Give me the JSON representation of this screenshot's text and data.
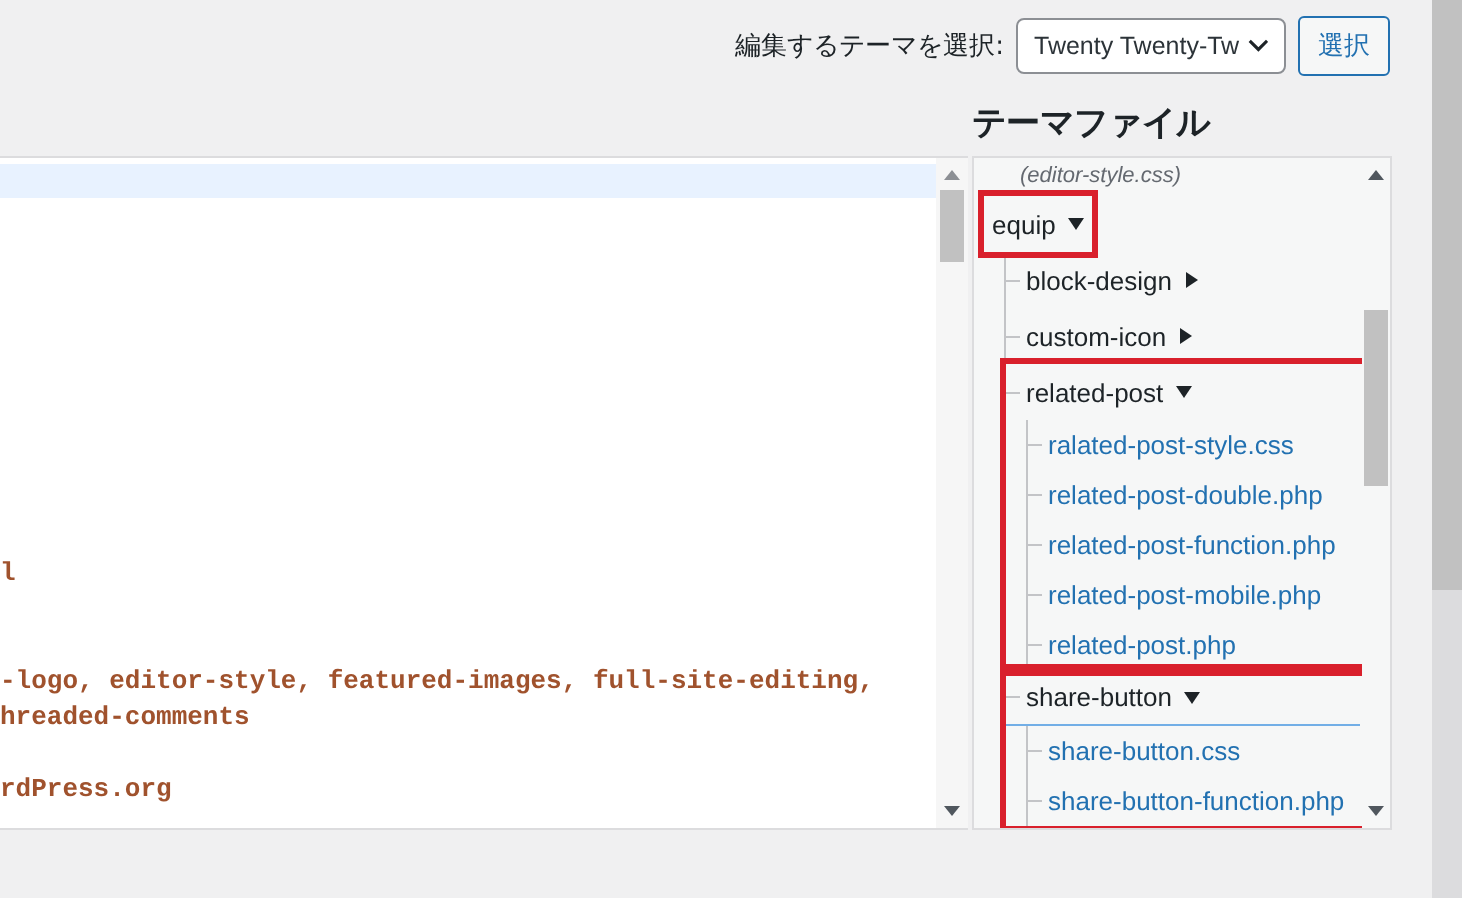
{
  "theme_picker": {
    "label": "編集するテーマを選択:",
    "value": "Twenty Twenty-Tw",
    "button": "選択"
  },
  "editor": {
    "code_blocks": [
      [
        "l"
      ],
      [
        "-logo, editor-style, featured-images, full-site-editing,",
        "hreaded-comments"
      ],
      [
        "rdPress.org"
      ]
    ]
  },
  "files": {
    "heading": "テーマファイル",
    "top_note": "(editor-style.css)",
    "tree": [
      {
        "label": "equip",
        "kind": "folder",
        "expanded": true,
        "selected": false,
        "label_highlighted": true,
        "children": [
          {
            "label": "block-design",
            "kind": "folder",
            "expanded": false,
            "selected": false
          },
          {
            "label": "custom-icon",
            "kind": "folder",
            "expanded": false,
            "selected": false
          },
          {
            "label": "related-post",
            "kind": "folder",
            "expanded": true,
            "selected": false,
            "highlighted": true,
            "children": [
              {
                "label": "ralated-post-style.css",
                "kind": "file",
                "selected": false
              },
              {
                "label": "related-post-double.php",
                "kind": "file",
                "selected": false
              },
              {
                "label": "related-post-function.php",
                "kind": "file",
                "selected": false
              },
              {
                "label": "related-post-mobile.php",
                "kind": "file",
                "selected": false
              },
              {
                "label": "related-post.php",
                "kind": "file",
                "selected": false
              }
            ]
          },
          {
            "label": "share-button",
            "kind": "folder",
            "expanded": true,
            "selected": true,
            "highlighted": true,
            "children": [
              {
                "label": "share-button.css",
                "kind": "file",
                "selected": false
              },
              {
                "label": "share-button-function.php",
                "kind": "file",
                "selected": false
              }
            ]
          }
        ]
      }
    ]
  }
}
